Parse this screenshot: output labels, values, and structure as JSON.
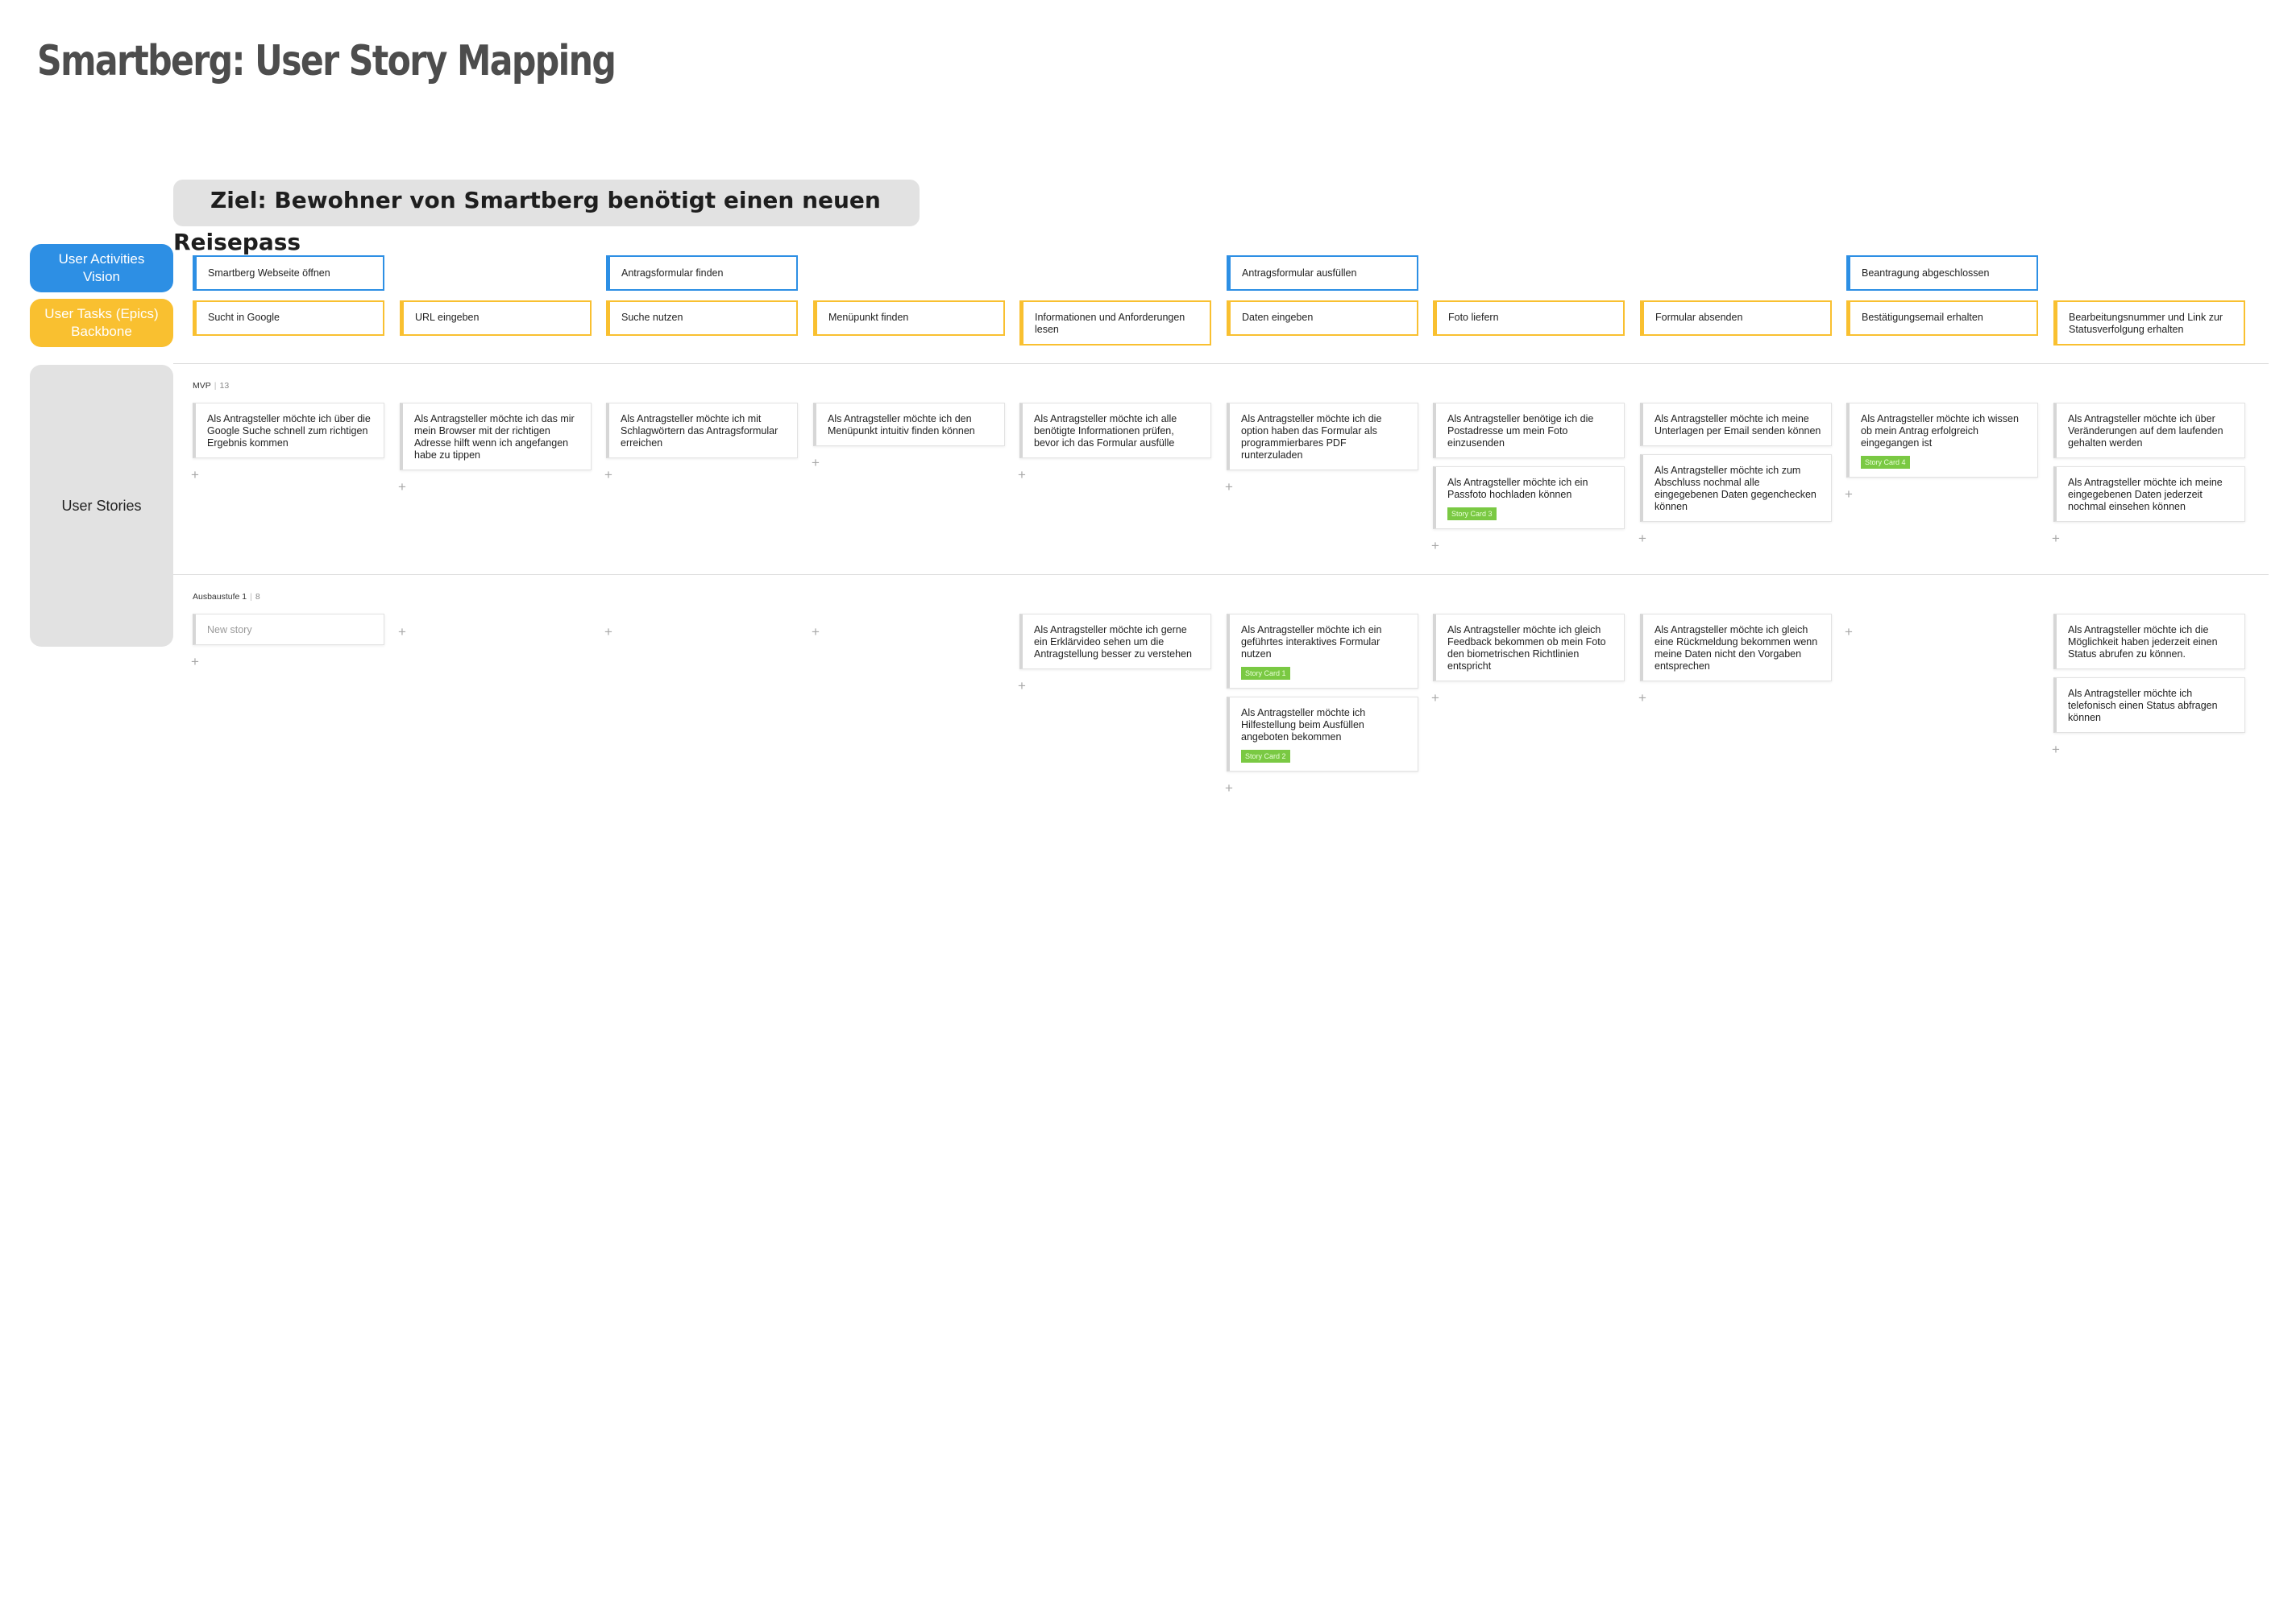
{
  "title": "Smartberg: User Story Mapping",
  "goal": "Ziel: Bewohner von Smartberg benötigt einen neuen Reisepass",
  "sidebar": {
    "activities": "User Activities\nVision",
    "tasks": "User Tasks (Epics)\nBackbone",
    "stories": "User Stories"
  },
  "activities": [
    {
      "col": 0,
      "label": "Smartberg Webseite öffnen"
    },
    {
      "col": 2,
      "label": "Antragsformular finden"
    },
    {
      "col": 5,
      "label": "Antragsformular ausfüllen"
    },
    {
      "col": 8,
      "label": "Beantragung abgeschlossen"
    }
  ],
  "tasks": [
    "Sucht in Google",
    "URL eingeben",
    "Suche nutzen",
    "Menüpunkt finden",
    "Informationen und Anforderungen lesen",
    "Daten eingeben",
    "Foto liefern",
    "Formular absenden",
    "Bestätigungsemail erhalten",
    "Bearbeitungsnummer und Link zur Statusverfolgung erhalten"
  ],
  "releases": [
    {
      "name": "MVP",
      "count": "13",
      "columns": [
        [
          {
            "text": "Als Antragsteller möchte ich über die Google Suche schnell zum richtigen Ergebnis kommen"
          }
        ],
        [
          {
            "text": "Als Antragsteller möchte ich das mir mein Browser mit der richtigen Adresse hilft wenn ich angefangen habe zu tippen"
          }
        ],
        [
          {
            "text": "Als Antragsteller möchte ich mit Schlagwörtern das Antragsformular erreichen"
          }
        ],
        [
          {
            "text": "Als Antragsteller möchte ich den Menüpunkt intuitiv finden können"
          }
        ],
        [
          {
            "text": "Als Antragsteller möchte ich alle benötigte Informationen prüfen, bevor ich das Formular ausfülle"
          }
        ],
        [
          {
            "text": "Als Antragsteller möchte ich die option haben das Formular als programmierbares PDF runterzuladen"
          }
        ],
        [
          {
            "text": "Als Antragsteller benötige ich die Postadresse um mein Foto einzusenden"
          },
          {
            "text": "Als Antragsteller möchte ich ein Passfoto hochladen können",
            "badge": "Story Card 3"
          }
        ],
        [
          {
            "text": "Als Antragsteller möchte ich meine Unterlagen per Email senden können"
          },
          {
            "text": "Als Antragsteller möchte ich zum Abschluss nochmal alle eingegebenen Daten gegenchecken können"
          }
        ],
        [
          {
            "text": "Als Antragsteller möchte ich wissen ob mein Antrag erfolgreich eingegangen ist",
            "badge": "Story Card 4"
          }
        ],
        [
          {
            "text": "Als Antragsteller möchte ich über Veränderungen auf dem laufenden gehalten werden"
          },
          {
            "text": "Als Antragsteller möchte ich meine eingegebenen Daten jederzeit nochmal einsehen können"
          }
        ]
      ]
    },
    {
      "name": "Ausbaustufe 1",
      "count": "8",
      "columns": [
        [
          {
            "text": "New story",
            "placeholder": true
          }
        ],
        [],
        [],
        [],
        [
          {
            "text": "Als Antragsteller möchte ich gerne ein Erklärvideo sehen um die Antragstellung besser zu verstehen"
          }
        ],
        [
          {
            "text": "Als Antragsteller möchte ich ein geführtes interaktives Formular nutzen",
            "badge": "Story Card 1"
          },
          {
            "text": "Als Antragsteller möchte ich Hilfestellung beim Ausfüllen angeboten bekommen",
            "badge": "Story Card 2"
          }
        ],
        [
          {
            "text": "Als Antragsteller möchte ich gleich Feedback bekommen ob mein Foto den biometrischen Richtlinien entspricht"
          }
        ],
        [
          {
            "text": "Als Antragsteller möchte ich gleich eine Rückmeldung bekommen wenn meine Daten nicht den Vorgaben entsprechen"
          }
        ],
        [],
        [
          {
            "text": "Als Antragsteller möchte ich die Möglichkeit haben jederzeit einen Status abrufen zu können."
          },
          {
            "text": "Als Antragsteller möchte ich telefonisch einen Status abfragen können"
          }
        ]
      ]
    }
  ],
  "add_symbol": "+",
  "colors": {
    "activity": "#2d8fe4",
    "task": "#f9c030",
    "badge": "#7ac943",
    "sidebar_grey": "#e2e2e2"
  }
}
